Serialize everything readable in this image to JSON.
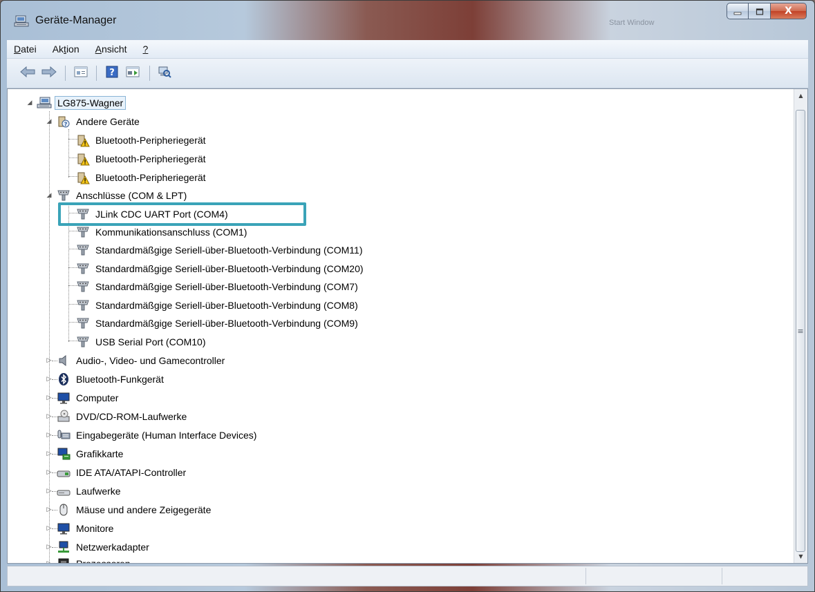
{
  "window": {
    "title": "Geräte-Manager",
    "background_window_title": "Start Window",
    "close_glyph": "X"
  },
  "menu": [
    {
      "pre": "",
      "acc": "D",
      "post": "atei"
    },
    {
      "pre": "Ak",
      "acc": "t",
      "post": "ion"
    },
    {
      "pre": "",
      "acc": "A",
      "post": "nsicht"
    },
    {
      "pre": "",
      "acc": "?",
      "post": ""
    }
  ],
  "toolbar": {
    "icons": [
      "back-arrow-icon",
      "forward-arrow-icon",
      "properties-icon",
      "help-icon",
      "update-driver-icon",
      "scan-hardware-icon"
    ]
  },
  "tree": {
    "root": {
      "label": "LG875-Wagner",
      "icon": "computer-network-icon",
      "expanded": true
    },
    "andere": {
      "label": "Andere Geräte",
      "icon": "unknown-device-icon",
      "items": [
        "Bluetooth-Peripheriegerät",
        "Bluetooth-Peripheriegerät",
        "Bluetooth-Peripheriegerät"
      ]
    },
    "anschluesse": {
      "label": "Anschlüsse (COM & LPT)",
      "icon": "port-icon",
      "items": [
        "JLink CDC UART Port (COM4)",
        "Kommunikationsanschluss (COM1)",
        "Standardmäßgige Seriell-über-Bluetooth-Verbindung (COM11)",
        "Standardmäßgige Seriell-über-Bluetooth-Verbindung (COM20)",
        "Standardmäßgige Seriell-über-Bluetooth-Verbindung (COM7)",
        "Standardmäßgige Seriell-über-Bluetooth-Verbindung (COM8)",
        "Standardmäßgige Seriell-über-Bluetooth-Verbindung (COM9)",
        "USB Serial Port (COM10)"
      ]
    },
    "categories": [
      {
        "label": "Audio-, Video- und Gamecontroller",
        "icon": "speaker-icon"
      },
      {
        "label": "Bluetooth-Funkgerät",
        "icon": "bluetooth-icon"
      },
      {
        "label": "Computer",
        "icon": "monitor-icon"
      },
      {
        "label": "DVD/CD-ROM-Laufwerke",
        "icon": "dvd-drive-icon"
      },
      {
        "label": "Eingabegeräte (Human Interface Devices)",
        "icon": "hid-icon"
      },
      {
        "label": "Grafikkarte",
        "icon": "display-adapter-icon"
      },
      {
        "label": "IDE ATA/ATAPI-Controller",
        "icon": "ide-controller-icon"
      },
      {
        "label": "Laufwerke",
        "icon": "disk-drive-icon"
      },
      {
        "label": "Mäuse und andere Zeigegeräte",
        "icon": "mouse-icon"
      },
      {
        "label": "Monitore",
        "icon": "monitor-icon"
      },
      {
        "label": "Netzwerkadapter",
        "icon": "network-adapter-icon"
      },
      {
        "label": "Prozessoren",
        "icon": "processor-icon"
      }
    ],
    "highlighted_item": "JLink CDC UART Port (COM4)"
  },
  "colors": {
    "highlight_border": "#3aa3b8",
    "selection_background": "#e8f2fb"
  }
}
